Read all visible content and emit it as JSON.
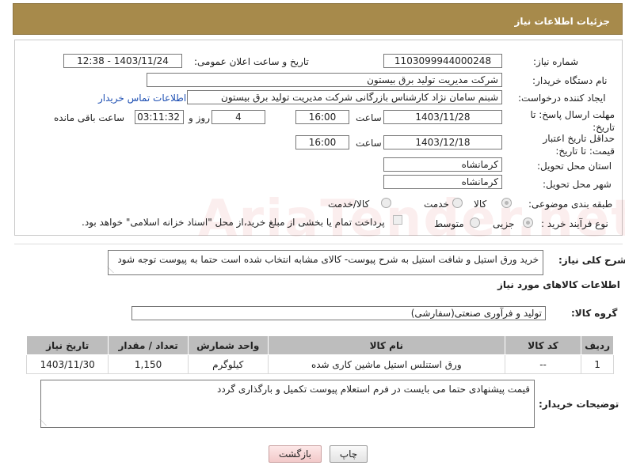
{
  "header": {
    "title": "جزئیات اطلاعات نیاز"
  },
  "form": {
    "need_number_label": "شماره نیاز:",
    "need_number": "1103099944000248",
    "announce_label": "تاریخ و ساعت اعلان عمومی:",
    "announce_value": "1403/11/24 - 12:38",
    "buyer_org_label": "نام دستگاه خریدار:",
    "buyer_org": "شرکت مدیریت تولید برق بیستون",
    "creator_label": "ایجاد کننده درخواست:",
    "creator": "شبنم سامان نژاد کارشناس بازرگانی شرکت مدیریت تولید برق بیستون",
    "contact_link": "اطلاعات تماس خریدار",
    "deadline_label": "مهلت ارسال پاسخ: تا تاریخ:",
    "deadline_date": "1403/11/28",
    "time_label": "ساعت",
    "deadline_time": "16:00",
    "days_value": "4",
    "days_label": "روز و",
    "remaining_time": "03:11:32",
    "remaining_label": "ساعت باقی مانده",
    "validity_label": "حداقل تاریخ اعتبار قیمت: تا تاریخ:",
    "validity_date": "1403/12/18",
    "validity_time": "16:00",
    "province_label": "استان محل تحویل:",
    "province": "کرمانشاه",
    "city_label": "شهر محل تحویل:",
    "city": "کرمانشاه",
    "category_label": "طبقه بندی موضوعی:",
    "category_options": [
      "کالا",
      "خدمت",
      "کالا/خدمت"
    ],
    "purchase_type_label": "نوع فرآیند خرید :",
    "purchase_options": [
      "جزیی",
      "متوسط"
    ],
    "treasury_note": "پرداخت تمام یا بخشی از مبلغ خرید،از محل \"اسناد خزانه اسلامی\" خواهد بود."
  },
  "description": {
    "label": "شرح کلی نیاز:",
    "text": "خرید ورق استیل و شافت استیل به شرح پیوست- کالای مشابه انتخاب شده است حتما به پیوست توجه شود"
  },
  "goods": {
    "section_title": "اطلاعات کالاهای مورد نیاز",
    "group_label": "گروه کالا:",
    "group_value": "تولید و فرآوری صنعتی(سفارشی)",
    "columns": [
      "ردیف",
      "کد کالا",
      "نام کالا",
      "واحد شمارش",
      "تعداد / مقدار",
      "تاریخ نیاز"
    ],
    "rows": [
      [
        "1",
        "--",
        "ورق استنلس استیل ماشین کاری شده",
        "کیلوگرم",
        "1,150",
        "1403/11/30"
      ]
    ]
  },
  "buyer_notes": {
    "label": "توضیحات خریدار:",
    "text": "قیمت پیشنهادی حتما می بایست در فرم استعلام پیوست تکمیل و بارگذاری گردد"
  },
  "buttons": {
    "print": "چاپ",
    "back": "بازگشت"
  },
  "watermark": "AriaTender.net"
}
